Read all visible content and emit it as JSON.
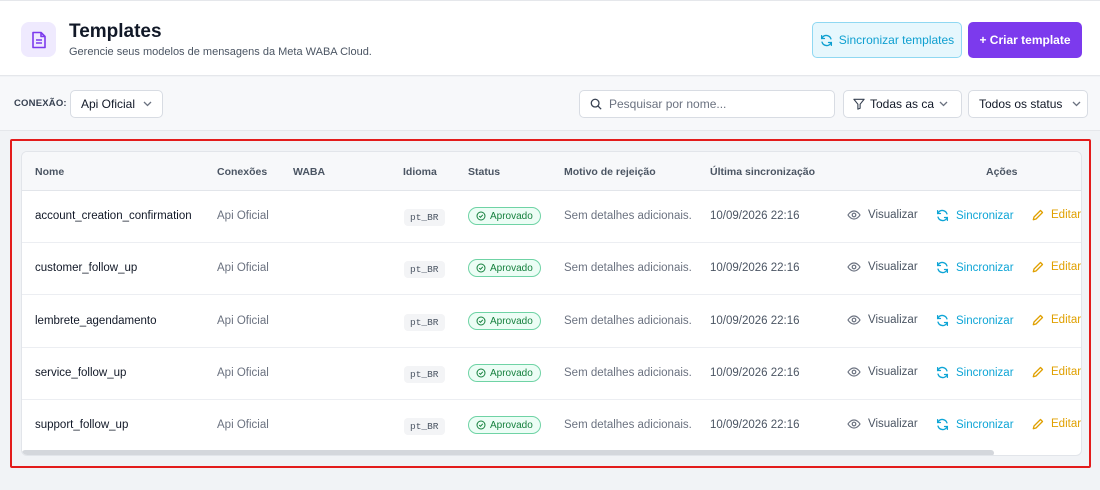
{
  "header": {
    "title": "Templates",
    "subtitle": "Gerencie seus modelos de mensagens da Meta WABA Cloud.",
    "icon": "document-icon",
    "sync_label": "Sincronizar templates",
    "create_label": "+ Criar template"
  },
  "filters": {
    "connection_label": "CONEXÃO:",
    "connection_value": "Api Oficial",
    "search_placeholder": "Pesquisar por nome...",
    "category_value": "Todas as categorias",
    "status_value": "Todos os status"
  },
  "table": {
    "columns": [
      "Nome",
      "Conexões",
      "WABA",
      "Idioma",
      "Status",
      "Motivo de rejeição",
      "Última sincronização",
      "Ações"
    ],
    "rows": [
      {
        "name": "account_creation_confirmation",
        "connection": "Api Oficial",
        "waba": "",
        "language": "pt_BR",
        "status": "Aprovado",
        "reason": "Sem detalhes adicionais.",
        "synced": "10/09/2026 22:16"
      },
      {
        "name": "customer_follow_up",
        "connection": "Api Oficial",
        "waba": "",
        "language": "pt_BR",
        "status": "Aprovado",
        "reason": "Sem detalhes adicionais.",
        "synced": "10/09/2026 22:16"
      },
      {
        "name": "lembrete_agendamento",
        "connection": "Api Oficial",
        "waba": "",
        "language": "pt_BR",
        "status": "Aprovado",
        "reason": "Sem detalhes adicionais.",
        "synced": "10/09/2026 22:16"
      },
      {
        "name": "service_follow_up",
        "connection": "Api Oficial",
        "waba": "",
        "language": "pt_BR",
        "status": "Aprovado",
        "reason": "Sem detalhes adicionais.",
        "synced": "10/09/2026 22:16"
      },
      {
        "name": "support_follow_up",
        "connection": "Api Oficial",
        "waba": "",
        "language": "pt_BR",
        "status": "Aprovado",
        "reason": "Sem detalhes adicionais.",
        "synced": "10/09/2026 22:16"
      }
    ],
    "actions": {
      "view": "Visualizar",
      "sync": "Sincronizar",
      "edit": "Editar"
    }
  },
  "colors": {
    "accent": "#7c3aed",
    "sync": "#0ea5d6",
    "edit": "#e0a000",
    "approved": "#15803d",
    "highlight": "#e31b1b"
  }
}
